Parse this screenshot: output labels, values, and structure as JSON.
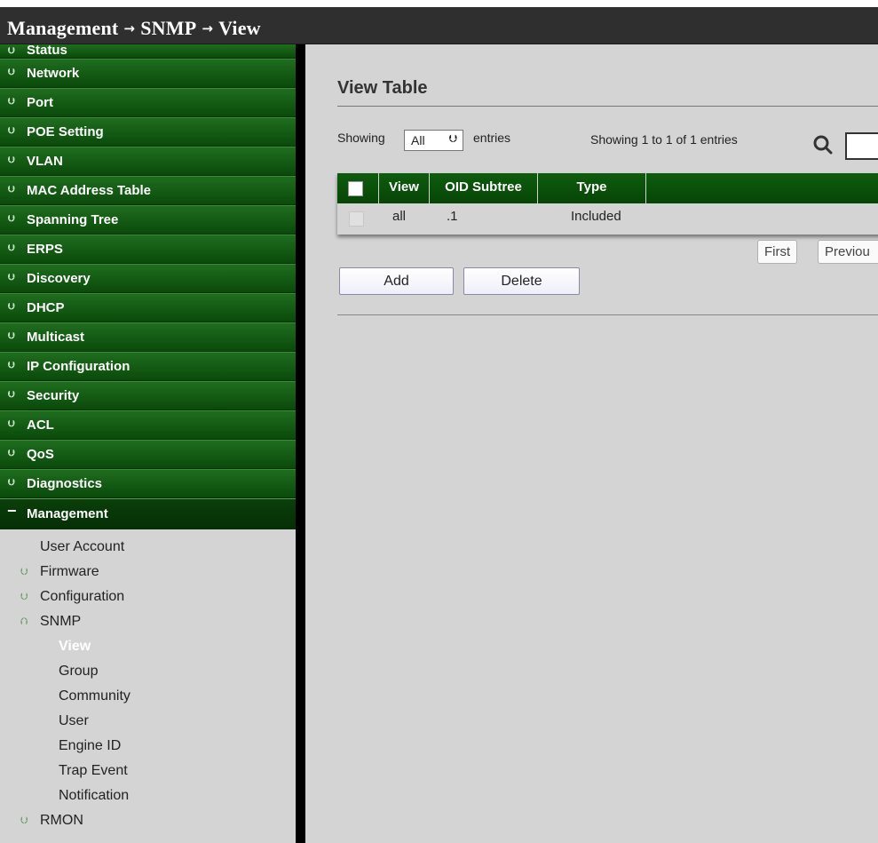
{
  "breadcrumb": {
    "part1": "Management",
    "part2": "SNMP",
    "part3": "View",
    "separator": "→"
  },
  "sidebar": {
    "items": [
      {
        "label": "Status"
      },
      {
        "label": "Network"
      },
      {
        "label": "Port"
      },
      {
        "label": "POE Setting"
      },
      {
        "label": "VLAN"
      },
      {
        "label": "MAC Address Table"
      },
      {
        "label": "Spanning Tree"
      },
      {
        "label": "ERPS"
      },
      {
        "label": "Discovery"
      },
      {
        "label": "DHCP"
      },
      {
        "label": "Multicast"
      },
      {
        "label": "IP Configuration"
      },
      {
        "label": "Security"
      },
      {
        "label": "ACL"
      },
      {
        "label": "QoS"
      },
      {
        "label": "Diagnostics"
      }
    ],
    "expanded": {
      "label": "Management",
      "icon": "−"
    },
    "submenu": [
      {
        "label": "User Account"
      },
      {
        "label": "Firmware"
      },
      {
        "label": "Configuration"
      },
      {
        "label": "SNMP"
      }
    ],
    "snmp_children": [
      {
        "label": "View"
      },
      {
        "label": "Group"
      },
      {
        "label": "Community"
      },
      {
        "label": "User"
      },
      {
        "label": "Engine ID"
      },
      {
        "label": "Trap Event"
      },
      {
        "label": "Notification"
      }
    ],
    "last_item": {
      "label": "RMON"
    }
  },
  "content": {
    "title": "View Table",
    "showing_label": "Showing",
    "entries_select": "All",
    "entries_label": "entries",
    "showing_info": "Showing 1 to 1 of 1 entries",
    "table": {
      "headers": {
        "view": "View",
        "oid": "OID Subtree",
        "type": "Type"
      },
      "rows": [
        {
          "view": "all",
          "oid": ".1",
          "type": "Included"
        }
      ]
    },
    "pagination": {
      "first": "First",
      "previous": "Previou"
    },
    "buttons": {
      "add": "Add",
      "delete": "Delete"
    }
  },
  "colors": {
    "menu_green": "#0f5c0f",
    "title_bar": "#2f2f2f",
    "panel": "#d4d4d4"
  }
}
